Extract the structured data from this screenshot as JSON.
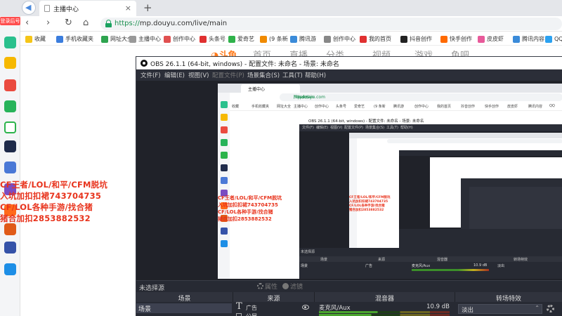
{
  "browser": {
    "tab_title": "主播中心",
    "tab_close": "×",
    "new_tab": "+",
    "nav": {
      "back": "‹",
      "forward": "›",
      "reload": "↻",
      "home": "⌂"
    },
    "url_scheme": "https://",
    "url_host": "mp.douyu.com",
    "url_path": "/live/main"
  },
  "bookmarks": [
    {
      "label": "收藏",
      "color": "#f5c518"
    },
    {
      "label": "手机收藏夹",
      "color": "#3b7ddd"
    },
    {
      "label": "网址大全",
      "color": "#2ea44f"
    },
    {
      "label": "主播中心",
      "color": "#999999"
    },
    {
      "label": "创作中心",
      "color": "#e05050"
    },
    {
      "label": "头条号",
      "color": "#e03030"
    },
    {
      "label": "爱奇艺",
      "color": "#2fb24a"
    },
    {
      "label": "(9 条新",
      "color": "#f08a00"
    },
    {
      "label": "腾讯游",
      "color": "#3b8bd9"
    },
    {
      "label": "创作中心",
      "color": "#888888"
    },
    {
      "label": "我的首页",
      "color": "#e03030"
    },
    {
      "label": "抖音创作",
      "color": "#222222"
    },
    {
      "label": "快手创作",
      "color": "#ff6a00"
    },
    {
      "label": "皮皮虾",
      "color": "#e85a9a"
    },
    {
      "label": "腾讯内容",
      "color": "#3b8bd9"
    },
    {
      "label": "QQ",
      "color": "#2ba1f0"
    }
  ],
  "sidebar": {
    "login_badge": "登录后号"
  },
  "douyu_nav": [
    "首页",
    "直播",
    "分类",
    "视频",
    "游戏",
    "鱼吧"
  ],
  "overlay_lines": [
    "CF王者/LOL/和平/CFM脱坑",
    "入坑加扣扣裙743704735",
    "CF/LOL各种手游/找合猪",
    "猪合加扣2853882532"
  ],
  "obs": {
    "title": "OBS 26.1.1 (64-bit, windows) - 配置文件: 未命名 - 场景: 未命名",
    "menu": [
      "文件(F)",
      "编辑(E)",
      "视图(V)",
      "配置文件(P)",
      "场景集合(S)",
      "工具(T)",
      "帮助(H)"
    ],
    "no_source": "未选择源",
    "properties": "属性",
    "filters": "滤镜",
    "docks": [
      "场景",
      "来源",
      "混音器",
      "转场特效"
    ],
    "scene_name": "场景",
    "sources": [
      "广告",
      "公屏"
    ],
    "mixer": {
      "label": "麦克风/Aux",
      "level": "10.9 dB"
    },
    "transition": "淡出",
    "transition_arrow": "⌃"
  },
  "nested": {
    "obs_title": "OBS 26.1.1 (64-bit, windows) - 配置文件: 未命名 - 场景: 未命名",
    "menu": [
      "文件(F)",
      "编辑(E)",
      "视图(V)",
      "配置文件(P)",
      "场景集合(S)",
      "工具(T)",
      "帮助(H)"
    ],
    "no_source": "未选择源",
    "headers": [
      "场景",
      "来源",
      "混音器",
      "转场特效"
    ],
    "scene_name": "场景",
    "source": "广告",
    "mixer_label": "麦克风/Aux",
    "mixer_level": "10.9 dB",
    "transition": "淡出"
  }
}
